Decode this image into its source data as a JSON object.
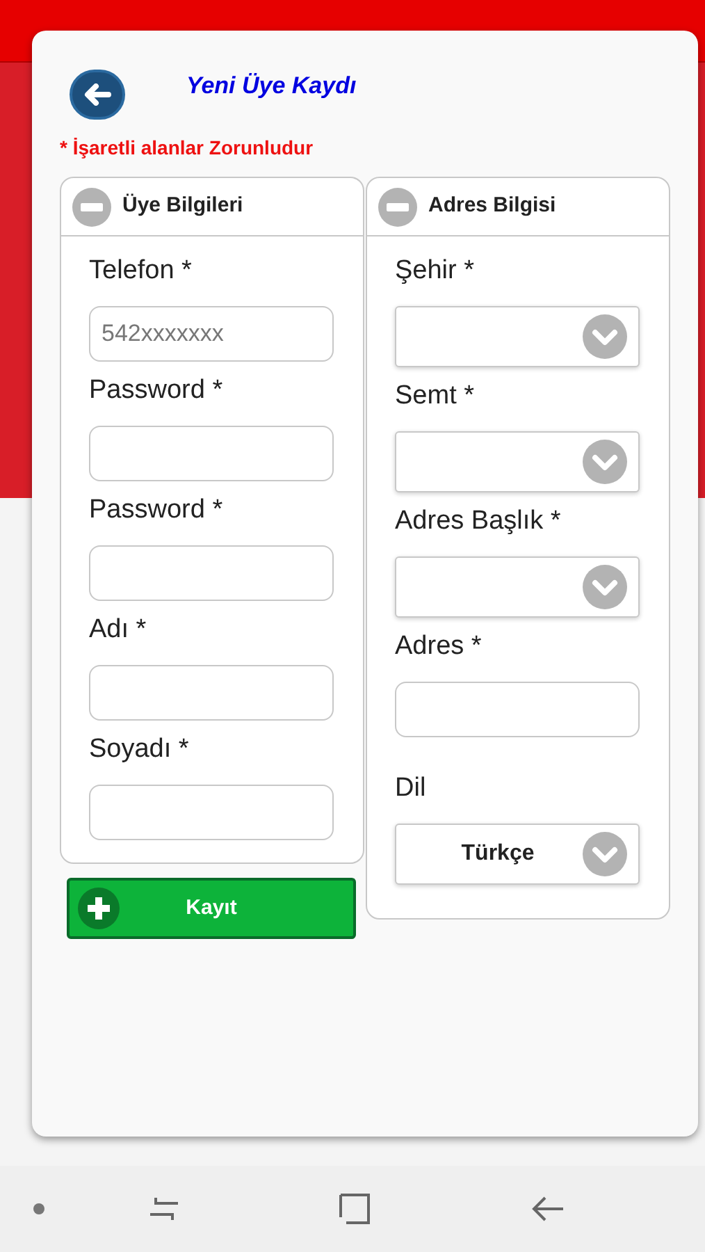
{
  "dialog": {
    "title": "Yeni Üye Kaydı",
    "required_note": "* İşaretli alanlar Zorunludur"
  },
  "panels": [
    {
      "title": "Üye Bilgileri",
      "expanded": true,
      "fields": [
        {
          "kind": "text",
          "label": "Telefon *",
          "placeholder": "542xxxxxxx"
        },
        {
          "kind": "text",
          "label": "Password *"
        },
        {
          "kind": "text",
          "label": "Password *"
        },
        {
          "kind": "text",
          "label": "Adı *"
        },
        {
          "kind": "text",
          "label": "Soyadı *"
        }
      ]
    },
    {
      "title": "Adres Bilgisi",
      "expanded": true,
      "fields": [
        {
          "kind": "select",
          "label": "Şehir *"
        },
        {
          "kind": "select",
          "label": "Semt *"
        },
        {
          "kind": "select",
          "label": "Adres Başlık *"
        },
        {
          "kind": "text",
          "label": "Adres *"
        },
        {
          "kind": "select",
          "label": "Dil",
          "value": "Türkçe"
        }
      ]
    }
  ],
  "save_button": {
    "label": "Kayıt"
  }
}
